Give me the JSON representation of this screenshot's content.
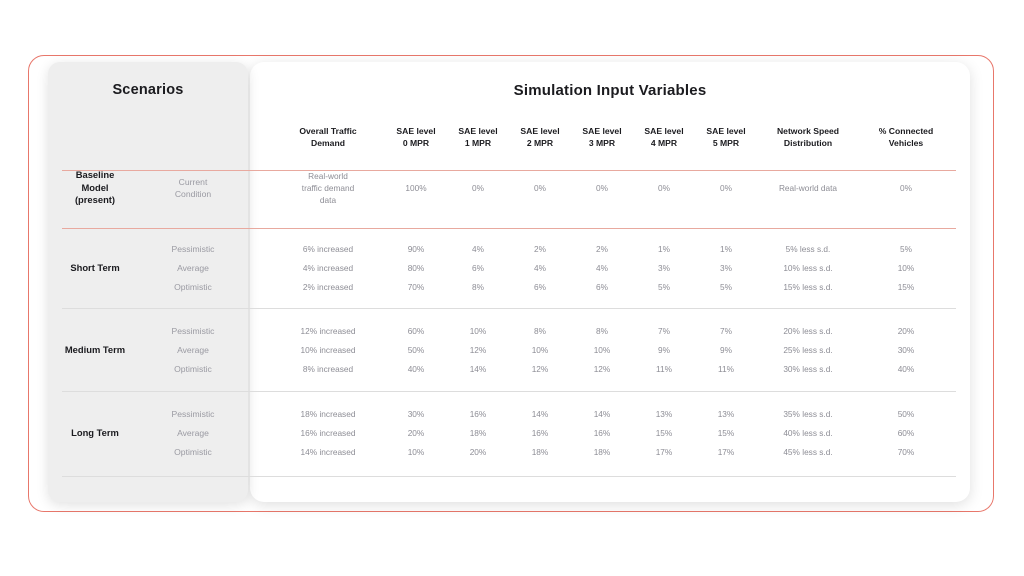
{
  "frame": {
    "accent_color": "#e8776b",
    "rule_red_color": "#e8a99f",
    "rule_gray_color": "#dddddd",
    "panel_bg": "#eeeeee",
    "card_bg": "#ffffff"
  },
  "left_panel": {
    "title": "Scenarios"
  },
  "right_panel": {
    "title": "Simulation Input Variables"
  },
  "columns": [
    {
      "label": "Overall Traffic\nDemand"
    },
    {
      "label": "SAE level\n0 MPR"
    },
    {
      "label": "SAE level\n1 MPR"
    },
    {
      "label": "SAE level\n2 MPR"
    },
    {
      "label": "SAE level\n3 MPR"
    },
    {
      "label": "SAE level\n4 MPR"
    },
    {
      "label": "SAE level\n5 MPR"
    },
    {
      "label": "Network Speed\nDistribution"
    },
    {
      "label": "% Connected\nVehicles"
    }
  ],
  "groups": [
    {
      "name": "Baseline Model (present)",
      "name_display": "Baseline\nModel\n(present)",
      "rows": [
        {
          "sub_label": "Current\nCondition",
          "values": [
            "Real-world\ntraffic demand\ndata",
            "100%",
            "0%",
            "0%",
            "0%",
            "0%",
            "0%",
            "Real-world data",
            "0%"
          ]
        }
      ]
    },
    {
      "name": "Short Term",
      "name_display": "Short Term",
      "rows": [
        {
          "sub_label": "Pessimistic",
          "values": [
            "6% increased",
            "90%",
            "4%",
            "2%",
            "2%",
            "1%",
            "1%",
            "5% less s.d.",
            "5%"
          ]
        },
        {
          "sub_label": "Average",
          "values": [
            "4% increased",
            "80%",
            "6%",
            "4%",
            "4%",
            "3%",
            "3%",
            "10% less s.d.",
            "10%"
          ]
        },
        {
          "sub_label": "Optimistic",
          "values": [
            "2% increased",
            "70%",
            "8%",
            "6%",
            "6%",
            "5%",
            "5%",
            "15% less s.d.",
            "15%"
          ]
        }
      ]
    },
    {
      "name": "Medium Term",
      "name_display": "Medium Term",
      "rows": [
        {
          "sub_label": "Pessimistic",
          "values": [
            "12% increased",
            "60%",
            "10%",
            "8%",
            "8%",
            "7%",
            "7%",
            "20% less s.d.",
            "20%"
          ]
        },
        {
          "sub_label": "Average",
          "values": [
            "10% increased",
            "50%",
            "12%",
            "10%",
            "10%",
            "9%",
            "9%",
            "25% less s.d.",
            "30%"
          ]
        },
        {
          "sub_label": "Optimistic",
          "values": [
            "8% increased",
            "40%",
            "14%",
            "12%",
            "12%",
            "11%",
            "11%",
            "30% less s.d.",
            "40%"
          ]
        }
      ]
    },
    {
      "name": "Long Term",
      "name_display": "Long Term",
      "rows": [
        {
          "sub_label": "Pessimistic",
          "values": [
            "18% increased",
            "30%",
            "16%",
            "14%",
            "14%",
            "13%",
            "13%",
            "35% less s.d.",
            "50%"
          ]
        },
        {
          "sub_label": "Average",
          "values": [
            "16% increased",
            "20%",
            "18%",
            "16%",
            "16%",
            "15%",
            "15%",
            "40% less s.d.",
            "60%"
          ]
        },
        {
          "sub_label": "Optimistic",
          "values": [
            "14% increased",
            "10%",
            "20%",
            "18%",
            "18%",
            "17%",
            "17%",
            "45% less s.d.",
            "70%"
          ]
        }
      ]
    }
  ]
}
